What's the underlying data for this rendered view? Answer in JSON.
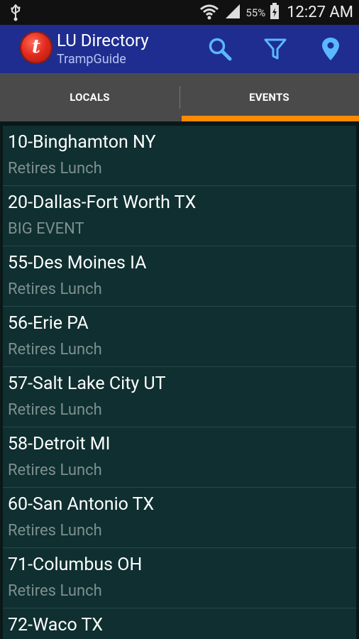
{
  "status_bar": {
    "battery_percent": "55%",
    "time": "12:27 AM",
    "icons": [
      "usb-icon",
      "wifi-icon",
      "signal-icon",
      "battery-icon"
    ]
  },
  "action_bar": {
    "title": "LU Directory",
    "subtitle": "TrampGuide",
    "logo_letter": "t",
    "icons": [
      "search-icon",
      "filter-icon",
      "location-pin-icon"
    ]
  },
  "tabs": [
    {
      "label": "LOCALS",
      "selected": false
    },
    {
      "label": "EVENTS",
      "selected": true
    }
  ],
  "colors": {
    "action_bar": "#1e2d8f",
    "tab_bar": "#4a4a4a",
    "tab_indicator": "#ff8a00",
    "list_background": "#0f2f30",
    "subtitle_text": "#7e8f8f"
  },
  "events": [
    {
      "local": "10-Binghamton NY",
      "event": "Retires Lunch"
    },
    {
      "local": "20-Dallas-Fort Worth TX",
      "event": "BIG EVENT"
    },
    {
      "local": "55-Des Moines IA",
      "event": "Retires Lunch"
    },
    {
      "local": "56-Erie PA",
      "event": "Retires Lunch"
    },
    {
      "local": "57-Salt Lake City UT",
      "event": "Retires Lunch"
    },
    {
      "local": "58-Detroit MI",
      "event": "Retires Lunch"
    },
    {
      "local": "60-San Antonio TX",
      "event": "Retires Lunch"
    },
    {
      "local": "71-Columbus OH",
      "event": "Retires Lunch"
    },
    {
      "local": "72-Waco TX",
      "event": ""
    }
  ]
}
